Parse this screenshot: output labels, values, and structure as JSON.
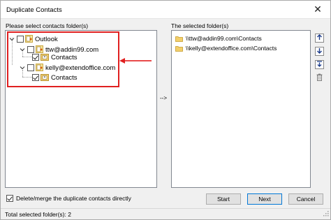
{
  "window": {
    "title": "Duplicate Contacts",
    "close_glyph": "✕"
  },
  "left": {
    "label": "Please select contacts folder(s)",
    "tree": {
      "root": "Outlook",
      "accounts": [
        {
          "name": "ttw@addin99.com",
          "child": "Contacts",
          "child_checked": true
        },
        {
          "name": "kelly@extendoffice.com",
          "child": "Contacts",
          "child_checked": true
        }
      ]
    }
  },
  "middle": {
    "move_label": "-->"
  },
  "right": {
    "label": "The selected folder(s)",
    "folders": [
      "\\\\ttw@addin99.com\\Contacts",
      "\\\\kelly@extendoffice.com\\Contacts"
    ],
    "side_buttons": [
      "arrow-up-icon",
      "arrow-down-icon",
      "move-to-bottom-icon",
      "trash-icon"
    ]
  },
  "bottom": {
    "delete_merge_label": "Delete/merge the duplicate contacts directly",
    "delete_merge_checked": true,
    "start_label": "Start",
    "next_label": "Next",
    "cancel_label": "Cancel"
  },
  "status": {
    "text": "Total selected folder(s): 2"
  },
  "colors": {
    "highlight": "#e02020",
    "folder": "#e8c25a",
    "default_button_border": "#0078d7"
  }
}
